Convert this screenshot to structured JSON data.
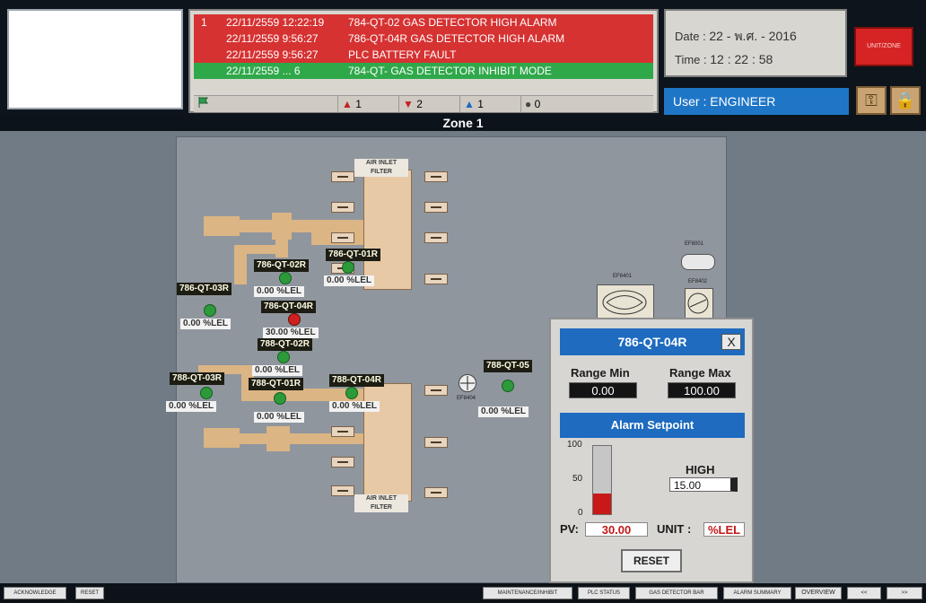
{
  "alarms": [
    {
      "num": "1",
      "timestamp": "22/11/2559 12:22:19",
      "message": "784-QT-02 GAS DETECTOR HIGH ALARM",
      "color": "#d63232"
    },
    {
      "num": "",
      "timestamp": "22/11/2559 9:56:27",
      "message": "786-QT-04R GAS DETECTOR HIGH ALARM",
      "color": "#d63232"
    },
    {
      "num": "",
      "timestamp": "22/11/2559 9:56:27",
      "message": "PLC BATTERY FAULT",
      "color": "#d63232"
    },
    {
      "num": "",
      "timestamp": "22/11/2559 ... 6",
      "message": "784-QT- GAS DETECTOR INHIBIT MODE",
      "color": "#2fa84a"
    }
  ],
  "alarm_counts": {
    "red": "1",
    "pink": "2",
    "blue": "1",
    "grey": "0"
  },
  "datetime": {
    "date_label": "Date :",
    "date_value": "22 - พ.ศ. - 2016",
    "time_label": "Time :",
    "time_value": "12 : 22 : 58"
  },
  "header_red_button": "UNIT/ZONE",
  "user": {
    "label": "User :",
    "name": "ENGINEER"
  },
  "zone_title": "Zone 1",
  "plant": {
    "filter_top_label": "AIR INLET FILTER",
    "filter_bottom_label": "AIR INLET FILTER",
    "tags": [
      {
        "id": "t1",
        "text": "786-QT-01R"
      },
      {
        "id": "t2",
        "text": "786-QT-02R"
      },
      {
        "id": "t3",
        "text": "786-QT-03R"
      },
      {
        "id": "t4",
        "text": "786-QT-04R"
      },
      {
        "id": "t5",
        "text": "788-QT-02R"
      },
      {
        "id": "t6",
        "text": "788-QT-03R"
      },
      {
        "id": "t7",
        "text": "788-QT-01R"
      },
      {
        "id": "t8",
        "text": "788-QT-04R"
      },
      {
        "id": "t9",
        "text": "788-QT-05"
      }
    ],
    "readings": [
      {
        "id": "r1",
        "text": "0.00  %LEL"
      },
      {
        "id": "r2",
        "text": "0.00  %LEL"
      },
      {
        "id": "r3",
        "text": "0.00  %LEL"
      },
      {
        "id": "r4",
        "text": "30.00  %LEL"
      },
      {
        "id": "r5",
        "text": "0.00  %LEL"
      },
      {
        "id": "r6",
        "text": "0.00  %LEL"
      },
      {
        "id": "r7",
        "text": "0.00  %LEL"
      },
      {
        "id": "r8",
        "text": "0.00  %LEL"
      },
      {
        "id": "r9",
        "text": "0.00  %LEL"
      }
    ],
    "equipment_labels": {
      "ep1": "EF8001",
      "ep2": "EF8401",
      "ep3": "EF8402",
      "ep4": "EF8404"
    }
  },
  "popup": {
    "title": "786-QT-04R",
    "close": "X",
    "range_min_label": "Range Min",
    "range_max_label": "Range Max",
    "range_min": "0.00",
    "range_max": "100.00",
    "setpoint_header": "Alarm Setpoint",
    "scale_ticks": [
      "100",
      "50",
      "0"
    ],
    "high_label": "HIGH",
    "high_value": "15.00",
    "pv_label": "PV:",
    "pv_value": "30.00",
    "unit_label": "UNIT :",
    "unit_value": "%LEL",
    "gauge_fill_percent": 30,
    "reset": "RESET"
  },
  "bottom_buttons": {
    "acknowledge": "ACKNOWLEDGE",
    "reset": "RESET",
    "maintenance": "MAINTENANCE/INHIBIT",
    "plc_status": "PLC STATUS",
    "gas_detector_bar": "GAS DETECTOR BAR",
    "alarm_summary": "ALARM SUMMARY",
    "overview": "OVERVIEW",
    "prev": "<<",
    "next": ">>"
  }
}
